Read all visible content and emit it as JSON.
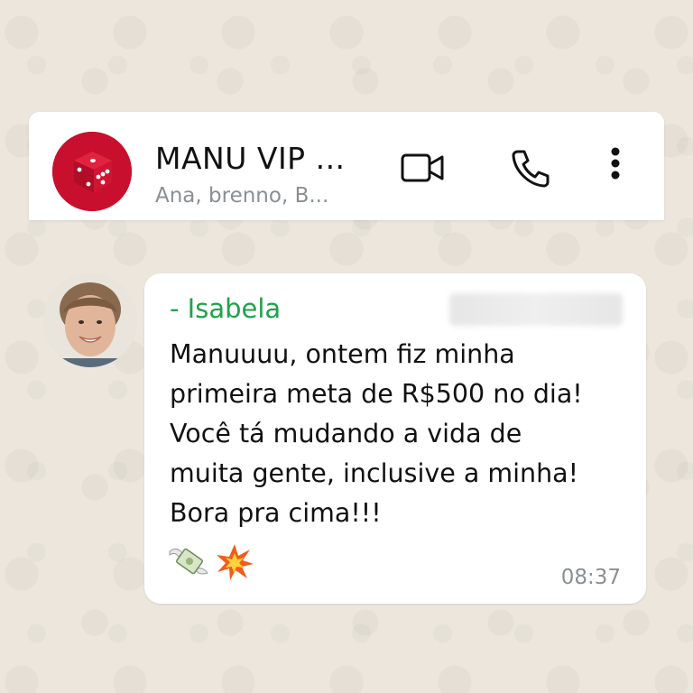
{
  "chat": {
    "title": "MANU VIP ...",
    "subtitle": "Ana, brenno, B...",
    "avatar_icon": "red-dice-icon",
    "actions": [
      "video-call-icon",
      "phone-call-icon",
      "more-options-icon"
    ]
  },
  "message": {
    "sender": "- Isabela",
    "text": "Manuuuu, ontem fiz minha\nprimeira meta de R$500 no dia!\nVocê tá mudando a vida de\nmuita gente, inclusive a minha!\nBora pra cima!!!",
    "emojis": [
      "money-with-wings-emoji",
      "collision-emoji"
    ],
    "time": "08:37"
  },
  "colors": {
    "sender_name": "#1ea34a",
    "avatar_red": "#c8102e",
    "wallpaper": "#ece6dc"
  }
}
